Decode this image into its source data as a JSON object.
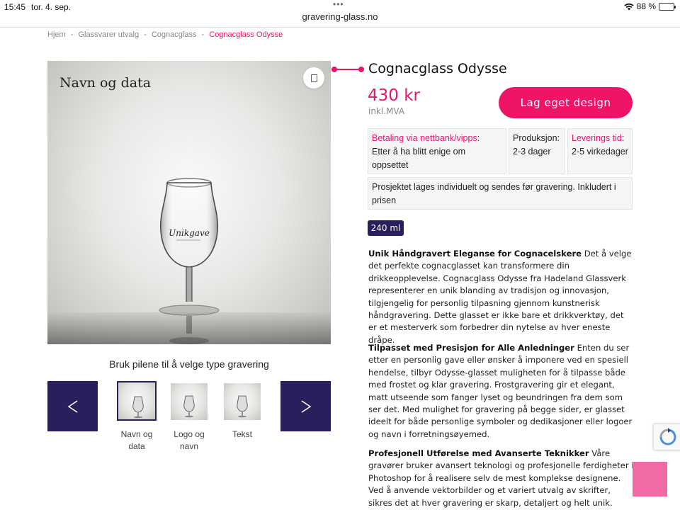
{
  "status": {
    "time": "15:45",
    "date": "tor. 4. sep.",
    "battery": "88 %",
    "battery_level": 0.88,
    "dots": "•••"
  },
  "browser": {
    "url": "gravering-glass.no"
  },
  "breadcrumb": {
    "items": [
      "Hjem",
      "-",
      "Glassvarer utvalg",
      "-",
      "Cognacglass",
      "-"
    ],
    "current": "Cognacglass Odysse"
  },
  "product": {
    "image_caption": "Navn og data",
    "engraving_text": "Unikgave",
    "title": "Cognacglass Odysse",
    "price": "430 kr",
    "vat": "inkl.MVA",
    "cta": "Lag eget design",
    "size": "240 ml"
  },
  "info": {
    "payment_label": "Betaling via nettbank/vipps",
    "payment_colon": ":",
    "payment_text": "Etter å ha blitt enige om oppsettet",
    "production_label": "Produksjon:",
    "production_text": "2-3 dager",
    "delivery_label": "Leverings tid",
    "delivery_colon": ":",
    "delivery_text": "2-5 virkedager",
    "project_text": "Prosjektet lages individuelt og sendes før gravering. Inkludert i prisen"
  },
  "selector": {
    "instruction": "Bruk pilene til å velge type gravering",
    "options": [
      {
        "label": "Navn og data"
      },
      {
        "label": "Logo og navn"
      },
      {
        "label": "Tekst"
      }
    ]
  },
  "description": [
    {
      "heading": "Unik Håndgravert Eleganse for Cognacelskere",
      "text": " Det å velge det perfekte cognacglasset kan transformere din drikkeopplevelse. Cognacglass Odysse fra Hadeland Glassverk representerer en unik blanding av tradisjon og innovasjon, tilgjengelig for personlig tilpasning gjennom kunstnerisk håndgravering. Dette glasset er ikke bare et drikkverktøy, det er et mesterverk som forbedrer din nytelse av hver eneste dråpe."
    },
    {
      "heading": "Tilpasset med Presisjon for Alle Anledninger",
      "text": " Enten du ser etter en personlig gave eller ønsker å imponere ved en spesiell hendelse, tilbyr Odysse-glasset muligheten for å tilpasse både med frostet og klar gravering. Frostgravering gir et elegant, matt utseende som fanger lyset og beundringen fra dem som ser det. Med mulighet for gravering på begge sider, er glasset ideelt for både personlige symboler og dedikasjoner eller logoer og navn i forretningsøyemed."
    },
    {
      "heading": "Profesjonell Utførelse med Avanserte Teknikker",
      "text": " Våre gravører bruker avansert teknologi og profesjonelle ferdigheter i Photoshop for å realisere selv de mest komplekse designene. Ved å anvende vektorbilder og et variert utvalg av skrifter, sikres det at hver gravering er skarp, detaljert og helt unik."
    }
  ],
  "colors": {
    "accent": "#e6176b",
    "cta": "#ef1468",
    "nav": "#2a1f5c"
  }
}
